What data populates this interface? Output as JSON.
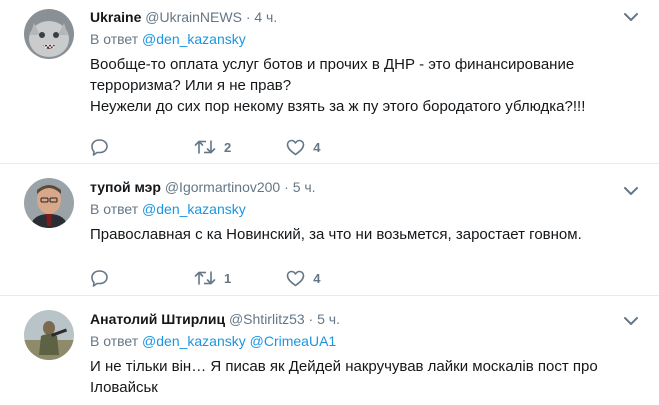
{
  "tweets": [
    {
      "name": "Ukraine",
      "handle": "@UkrainNEWS",
      "dot": "·",
      "time": "4 ч.",
      "reply_prefix": "В ответ",
      "mentions": [
        "@den_kazansky"
      ],
      "lines": [
        "Вообще-то оплата услуг ботов и прочих в ДНР - это финансирование терроризма? Или я не прав?",
        "Неужели до сих пор некому взять за ж пу этого бородатого ублюдка?!!!"
      ],
      "retweets": "2",
      "likes": "4"
    },
    {
      "name": "тупой мэр",
      "handle": "@Igormartinov200",
      "dot": "·",
      "time": "5 ч.",
      "reply_prefix": "В ответ",
      "mentions": [
        "@den_kazansky"
      ],
      "lines": [
        "Православная с ка Новинский, за что ни возьмется, заростает говном."
      ],
      "retweets": "1",
      "likes": "4"
    },
    {
      "name": "Анатолий Штирлиц",
      "handle": "@Shtirlitz53",
      "dot": "·",
      "time": "5 ч.",
      "reply_prefix": "В ответ",
      "mentions": [
        "@den_kazansky",
        "@CrimeaUA1"
      ],
      "lines": [
        "И не тільки він… Я писав як Дейдей накручував лайки москалів пост про Іловайськ"
      ]
    }
  ],
  "icons": {
    "reply": "reply-icon",
    "retweet": "retweet-icon",
    "like": "heart-icon",
    "more": "chevron-down-icon"
  },
  "colors": {
    "text": "#14171a",
    "secondary": "#657786",
    "link": "#1b95e0",
    "divider": "#e6ecf0"
  }
}
